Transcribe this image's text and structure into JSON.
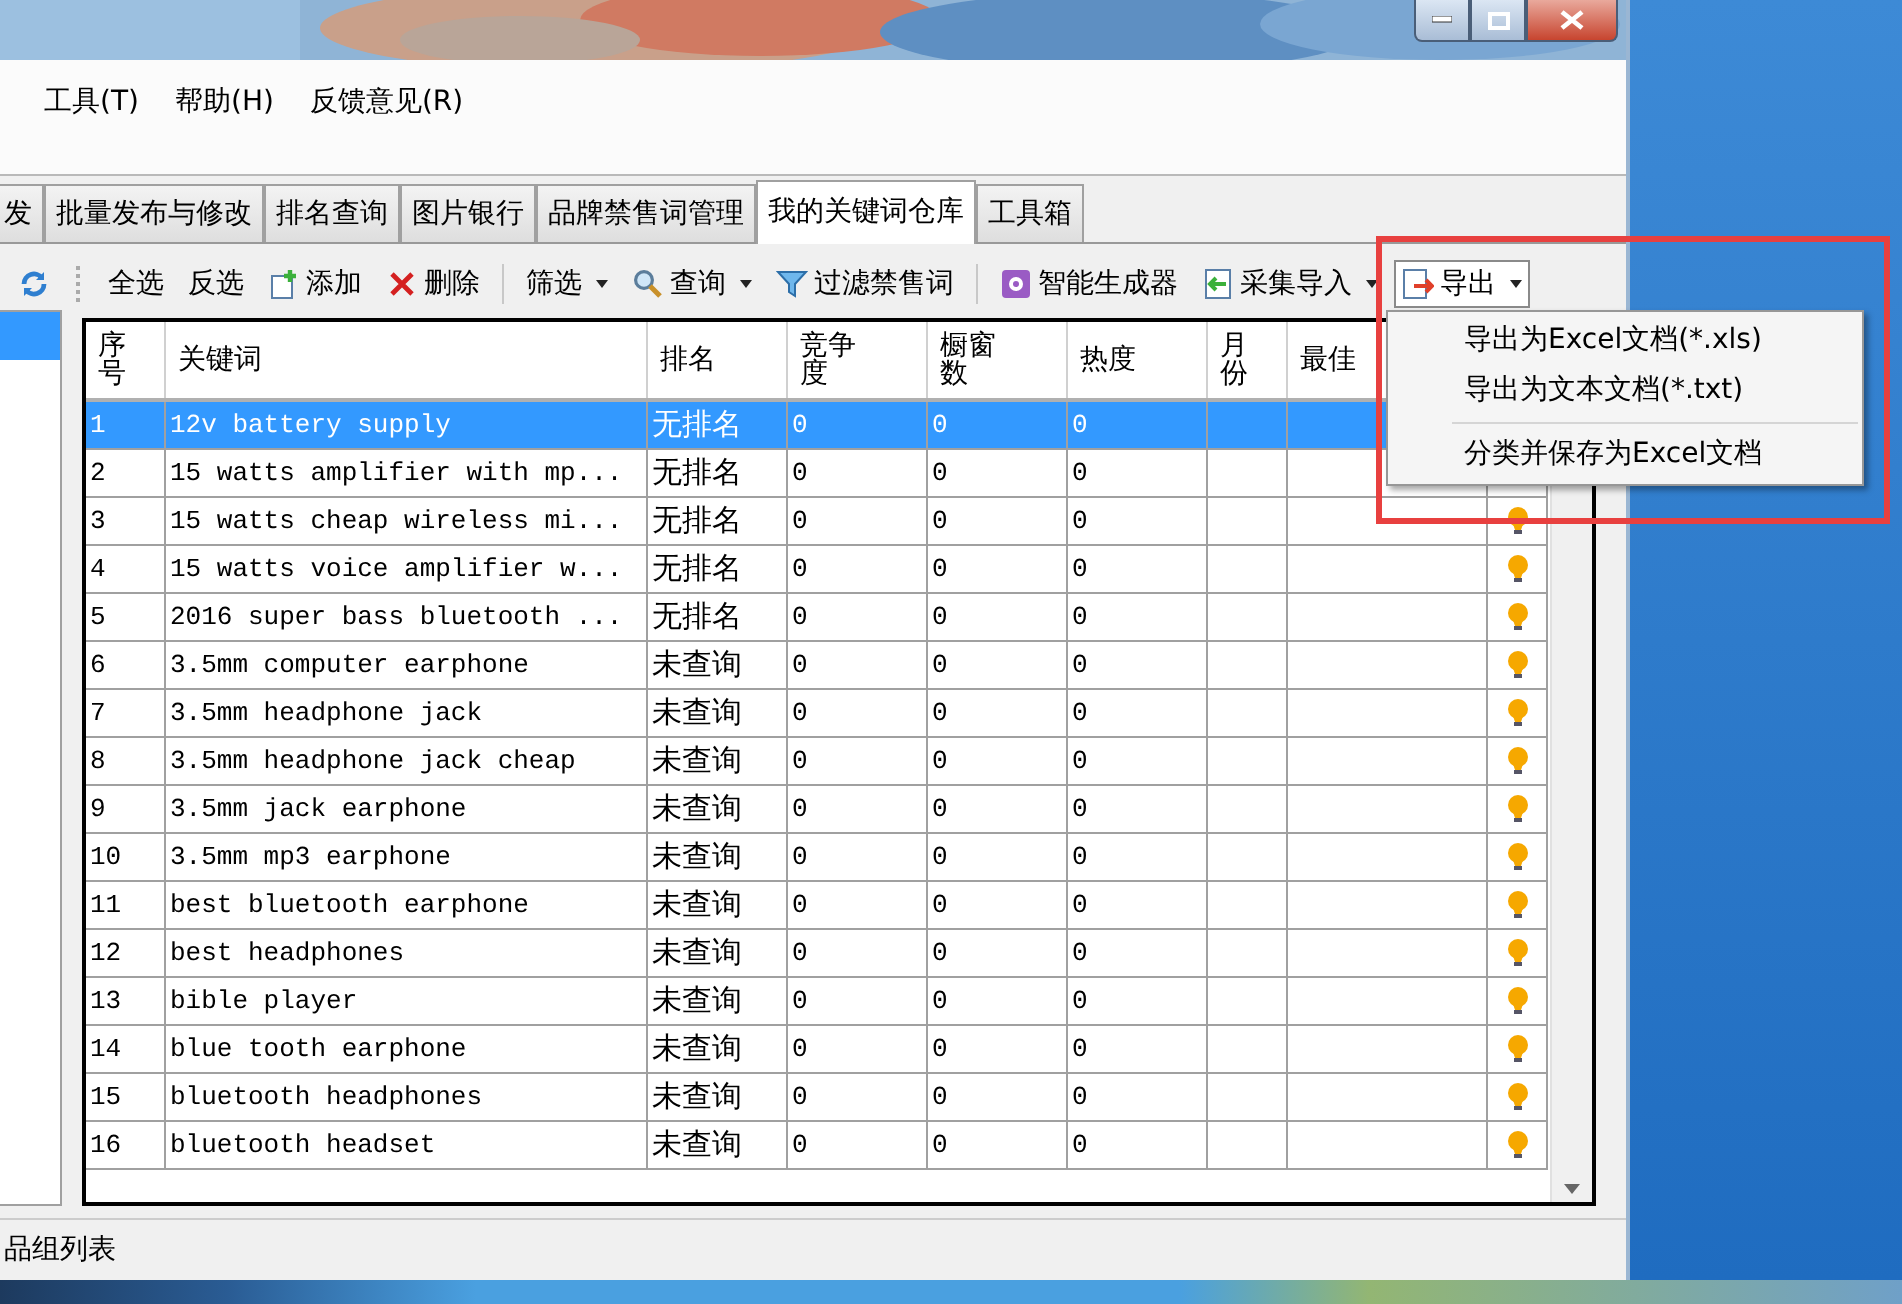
{
  "menu": [
    {
      "label": "工具(T)"
    },
    {
      "label": "帮助(H)"
    },
    {
      "label": "反馈意见(R)"
    }
  ],
  "tabs": [
    {
      "label": "发",
      "selected": false
    },
    {
      "label": "批量发布与修改",
      "selected": false
    },
    {
      "label": "排名查询",
      "selected": false
    },
    {
      "label": "图片银行",
      "selected": false
    },
    {
      "label": "品牌禁售词管理",
      "selected": false
    },
    {
      "label": "我的关键词仓库",
      "selected": true
    },
    {
      "label": "工具箱",
      "selected": false
    }
  ],
  "sidebar": {
    "items": [
      {
        "selected": true
      }
    ]
  },
  "toolbar": [
    {
      "kind": "button",
      "label": "全选",
      "dropdown": false,
      "pressed": false
    },
    {
      "kind": "button",
      "label": "反选",
      "dropdown": false,
      "pressed": false
    },
    {
      "kind": "button",
      "label": "添加",
      "dropdown": false,
      "pressed": false
    },
    {
      "kind": "button",
      "label": "删除",
      "dropdown": false,
      "pressed": false
    },
    {
      "kind": "separator"
    },
    {
      "kind": "button",
      "label": "筛选",
      "dropdown": true,
      "pressed": false
    },
    {
      "kind": "button",
      "label": "查询",
      "dropdown": true,
      "pressed": false
    },
    {
      "kind": "button",
      "label": "过滤禁售词",
      "dropdown": false,
      "pressed": false
    },
    {
      "kind": "separator"
    },
    {
      "kind": "button",
      "label": "智能生成器",
      "dropdown": false,
      "pressed": false
    },
    {
      "kind": "button",
      "label": "采集导入",
      "dropdown": true,
      "pressed": false
    },
    {
      "kind": "button",
      "label": "导出",
      "dropdown": true,
      "pressed": true
    }
  ],
  "table": {
    "columns": [
      "序号",
      "关键词",
      "排名",
      "竞争度",
      "橱窗数",
      "热度",
      "月份",
      "最佳"
    ],
    "rows": [
      {
        "cells": [
          "1",
          "12v battery supply",
          "无排名",
          "0",
          "0",
          "0"
        ],
        "selected": true
      },
      {
        "cells": [
          "2",
          "15 watts amplifier with mp...",
          "无排名",
          "0",
          "0",
          "0"
        ],
        "selected": false
      },
      {
        "cells": [
          "3",
          "15 watts cheap wireless mi...",
          "无排名",
          "0",
          "0",
          "0"
        ],
        "selected": false
      },
      {
        "cells": [
          "4",
          "15 watts voice amplifier w...",
          "无排名",
          "0",
          "0",
          "0"
        ],
        "selected": false
      },
      {
        "cells": [
          "5",
          "2016 super bass bluetooth ...",
          "无排名",
          "0",
          "0",
          "0"
        ],
        "selected": false
      },
      {
        "cells": [
          "6",
          "3.5mm computer earphone",
          "未查询",
          "0",
          "0",
          "0"
        ],
        "selected": false
      },
      {
        "cells": [
          "7",
          "3.5mm headphone jack",
          "未查询",
          "0",
          "0",
          "0"
        ],
        "selected": false
      },
      {
        "cells": [
          "8",
          "3.5mm headphone jack cheap",
          "未查询",
          "0",
          "0",
          "0"
        ],
        "selected": false
      },
      {
        "cells": [
          "9",
          "3.5mm jack earphone",
          "未查询",
          "0",
          "0",
          "0"
        ],
        "selected": false
      },
      {
        "cells": [
          "10",
          "3.5mm mp3 earphone",
          "未查询",
          "0",
          "0",
          "0"
        ],
        "selected": false
      },
      {
        "cells": [
          "11",
          "best bluetooth earphone",
          "未查询",
          "0",
          "0",
          "0"
        ],
        "selected": false
      },
      {
        "cells": [
          "12",
          "best headphones",
          "未查询",
          "0",
          "0",
          "0"
        ],
        "selected": false
      },
      {
        "cells": [
          "13",
          "bible player",
          "未查询",
          "0",
          "0",
          "0"
        ],
        "selected": false
      },
      {
        "cells": [
          "14",
          "blue tooth earphone",
          "未查询",
          "0",
          "0",
          "0"
        ],
        "selected": false
      },
      {
        "cells": [
          "15",
          "bluetooth headphones",
          "未查询",
          "0",
          "0",
          "0"
        ],
        "selected": false
      },
      {
        "cells": [
          "16",
          "bluetooth headset",
          "未查询",
          "0",
          "0",
          "0"
        ],
        "selected": false
      }
    ]
  },
  "export_menu": {
    "items": [
      {
        "kind": "item",
        "label": "导出为Excel文档(*.xls)"
      },
      {
        "kind": "item",
        "label": "导出为文本文档(*.txt)"
      },
      {
        "kind": "separator"
      },
      {
        "kind": "item",
        "label": "分类并保存为Excel文档"
      }
    ]
  },
  "status_bar": {
    "text": "品组列表"
  }
}
